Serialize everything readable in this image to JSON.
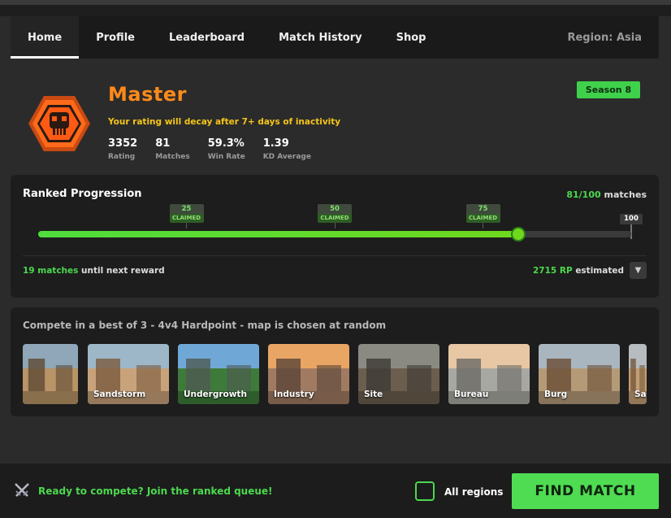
{
  "nav": {
    "items": [
      {
        "label": "Home",
        "active": true
      },
      {
        "label": "Profile",
        "active": false
      },
      {
        "label": "Leaderboard",
        "active": false
      },
      {
        "label": "Match History",
        "active": false
      },
      {
        "label": "Shop",
        "active": false
      }
    ],
    "region": "Region: Asia"
  },
  "rank": {
    "title": "Master",
    "icon": "skull-badge-icon",
    "decay_notice": "Your rating will decay after 7+ days of inactivity",
    "season": "Season 8",
    "stats": [
      {
        "value": "3352",
        "label": "Rating"
      },
      {
        "value": "81",
        "label": "Matches"
      },
      {
        "value": "59.3%",
        "label": "Win Rate"
      },
      {
        "value": "1.39",
        "label": "KD Average"
      }
    ]
  },
  "progression": {
    "title": "Ranked Progression",
    "played": "81/100",
    "played_suffix": "matches",
    "progress_matches": 81,
    "max_matches": 100,
    "milestones": [
      {
        "value": "25",
        "status": "CLAIMED",
        "at": 25
      },
      {
        "value": "50",
        "status": "CLAIMED",
        "at": 50
      },
      {
        "value": "75",
        "status": "CLAIMED",
        "at": 75
      }
    ],
    "end_milestone": "100",
    "next_reward_count": "19 matches",
    "next_reward_suffix": "until next reward",
    "rp_value": "2715 RP",
    "rp_suffix": "estimated"
  },
  "maps": {
    "description": "Compete in a best of 3 - 4v4 Hardpoint - map is chosen at random",
    "cards": [
      {
        "name": "",
        "palette": [
          "#8fa7b8",
          "#b89466",
          "#5e4a34"
        ]
      },
      {
        "name": "Sandstorm",
        "palette": [
          "#9db7c9",
          "#c8a27a",
          "#7a5a3e"
        ]
      },
      {
        "name": "Undergrowth",
        "palette": [
          "#6fa8d6",
          "#3e7b3a",
          "#4f5a52"
        ]
      },
      {
        "name": "Industry",
        "palette": [
          "#e9a564",
          "#a17a62",
          "#5a4538"
        ]
      },
      {
        "name": "Site",
        "palette": [
          "#8a8a82",
          "#6b5e4e",
          "#3d3a36"
        ]
      },
      {
        "name": "Bureau",
        "palette": [
          "#e7c7a4",
          "#a8a8a2",
          "#6c6a66"
        ]
      },
      {
        "name": "Burg",
        "palette": [
          "#a9b6c0",
          "#b59a78",
          "#6a4e36"
        ]
      },
      {
        "name": "Sa",
        "palette": [
          "#b6bcc0",
          "#c29e74",
          "#77583c"
        ]
      }
    ]
  },
  "footer": {
    "message": "Ready to compete? Join the ranked queue!",
    "checkbox_label": "All regions",
    "checkbox_checked": false,
    "button": "FIND MATCH"
  },
  "colors": {
    "accent_green": "#4fdc52",
    "rank_orange": "#ff8a1a",
    "warning_yellow": "#f5c518"
  }
}
